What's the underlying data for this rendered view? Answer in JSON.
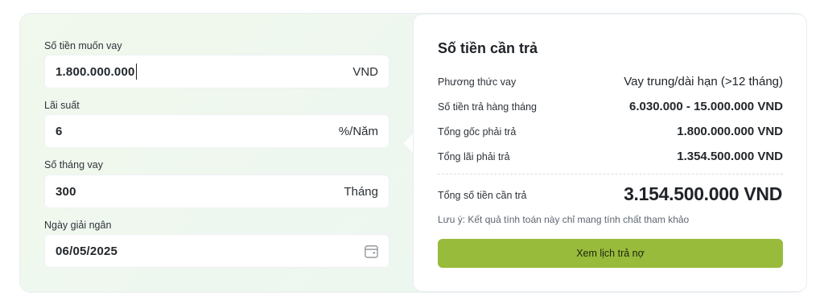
{
  "form": {
    "amount": {
      "label": "Số tiền muốn vay",
      "value": "1.800.000.000",
      "unit": "VND"
    },
    "rate": {
      "label": "Lãi suất",
      "value": "6",
      "unit": "%/Năm"
    },
    "months": {
      "label": "Số tháng vay",
      "value": "300",
      "unit": "Tháng"
    },
    "date": {
      "label": "Ngày giải ngân",
      "value": "06/05/2025",
      "icon": "calendar-icon"
    }
  },
  "result": {
    "title": "Số tiền cần trả",
    "rows": [
      {
        "label": "Phương thức vay",
        "value": "Vay trung/dài hạn (>12 tháng)"
      },
      {
        "label": "Số tiền trả hàng tháng",
        "value": "6.030.000 - 15.000.000 VND"
      },
      {
        "label": "Tổng gốc phải trả",
        "value": "1.800.000.000 VND"
      },
      {
        "label": "Tổng lãi phải trả",
        "value": "1.354.500.000 VND"
      }
    ],
    "total_label": "Tổng số tiền cần trả",
    "total_value": "3.154.500.000 VND",
    "note": "Lưu ý: Kết quả tính toán này chỉ mang tính chất tham khảo",
    "button_label": "Xem lịch trả nợ"
  },
  "colors": {
    "button": "#98bb3c",
    "panel_bg": "#ffffff",
    "card_bg": "#eef7ef"
  }
}
